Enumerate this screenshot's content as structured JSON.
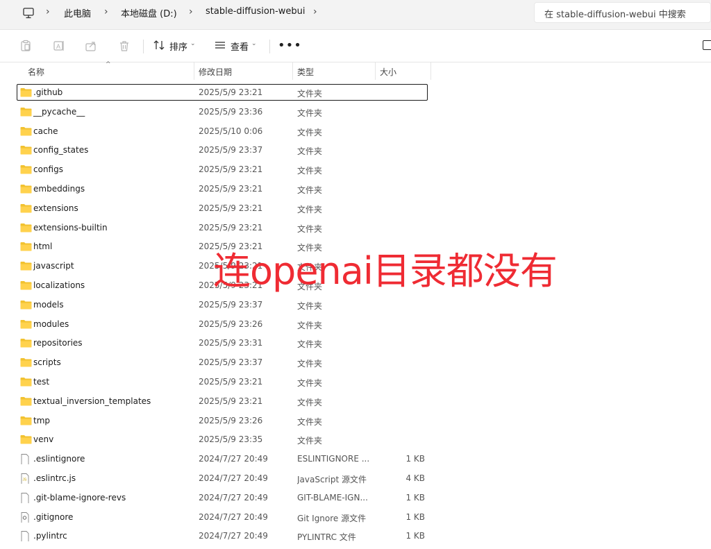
{
  "address": {
    "crumbs": [
      "此电脑",
      "本地磁盘 (D:)",
      "stable-diffusion-webui"
    ],
    "search_placeholder": "在 stable-diffusion-webui 中搜索"
  },
  "toolbar": {
    "sort_label": "排序",
    "view_label": "查看",
    "more_label": "•••"
  },
  "columns": {
    "name": "名称",
    "date": "修改日期",
    "type": "类型",
    "size": "大小"
  },
  "rows": [
    {
      "name": ".github",
      "date": "2025/5/9 23:21",
      "type": "文件夹",
      "size": "",
      "icon": "folder-icon"
    },
    {
      "name": "__pycache__",
      "date": "2025/5/9 23:36",
      "type": "文件夹",
      "size": "",
      "icon": "folder-icon"
    },
    {
      "name": "cache",
      "date": "2025/5/10 0:06",
      "type": "文件夹",
      "size": "",
      "icon": "folder-icon"
    },
    {
      "name": "config_states",
      "date": "2025/5/9 23:37",
      "type": "文件夹",
      "size": "",
      "icon": "folder-icon"
    },
    {
      "name": "configs",
      "date": "2025/5/9 23:21",
      "type": "文件夹",
      "size": "",
      "icon": "folder-icon"
    },
    {
      "name": "embeddings",
      "date": "2025/5/9 23:21",
      "type": "文件夹",
      "size": "",
      "icon": "folder-icon"
    },
    {
      "name": "extensions",
      "date": "2025/5/9 23:21",
      "type": "文件夹",
      "size": "",
      "icon": "folder-icon"
    },
    {
      "name": "extensions-builtin",
      "date": "2025/5/9 23:21",
      "type": "文件夹",
      "size": "",
      "icon": "folder-icon"
    },
    {
      "name": "html",
      "date": "2025/5/9 23:21",
      "type": "文件夹",
      "size": "",
      "icon": "folder-icon"
    },
    {
      "name": "javascript",
      "date": "2025/5/9 23:21",
      "type": "文件夹",
      "size": "",
      "icon": "folder-icon"
    },
    {
      "name": "localizations",
      "date": "2025/5/9 23:21",
      "type": "文件夹",
      "size": "",
      "icon": "folder-icon"
    },
    {
      "name": "models",
      "date": "2025/5/9 23:37",
      "type": "文件夹",
      "size": "",
      "icon": "folder-icon"
    },
    {
      "name": "modules",
      "date": "2025/5/9 23:26",
      "type": "文件夹",
      "size": "",
      "icon": "folder-icon"
    },
    {
      "name": "repositories",
      "date": "2025/5/9 23:31",
      "type": "文件夹",
      "size": "",
      "icon": "folder-icon"
    },
    {
      "name": "scripts",
      "date": "2025/5/9 23:37",
      "type": "文件夹",
      "size": "",
      "icon": "folder-icon"
    },
    {
      "name": "test",
      "date": "2025/5/9 23:21",
      "type": "文件夹",
      "size": "",
      "icon": "folder-icon"
    },
    {
      "name": "textual_inversion_templates",
      "date": "2025/5/9 23:21",
      "type": "文件夹",
      "size": "",
      "icon": "folder-icon"
    },
    {
      "name": "tmp",
      "date": "2025/5/9 23:26",
      "type": "文件夹",
      "size": "",
      "icon": "folder-icon"
    },
    {
      "name": "venv",
      "date": "2025/5/9 23:35",
      "type": "文件夹",
      "size": "",
      "icon": "folder-icon"
    },
    {
      "name": ".eslintignore",
      "date": "2024/7/27 20:49",
      "type": "ESLINTIGNORE ...",
      "size": "1 KB",
      "icon": "file-icon"
    },
    {
      "name": ".eslintrc.js",
      "date": "2024/7/27 20:49",
      "type": "JavaScript 源文件",
      "size": "4 KB",
      "icon": "js-file-icon"
    },
    {
      "name": ".git-blame-ignore-revs",
      "date": "2024/7/27 20:49",
      "type": "GIT-BLAME-IGN...",
      "size": "1 KB",
      "icon": "file-icon"
    },
    {
      "name": ".gitignore",
      "date": "2024/7/27 20:49",
      "type": "Git Ignore 源文件",
      "size": "1 KB",
      "icon": "gitignore-file-icon"
    },
    {
      "name": ".pylintrc",
      "date": "2024/7/27 20:49",
      "type": "PYLINTRC 文件",
      "size": "1 KB",
      "icon": "file-icon"
    }
  ],
  "annotation": "连openai目录都没有",
  "colors": {
    "folder": "#f2c230",
    "annotation": "#ef2b33",
    "toolbar_bg": "#f3f3f3"
  }
}
